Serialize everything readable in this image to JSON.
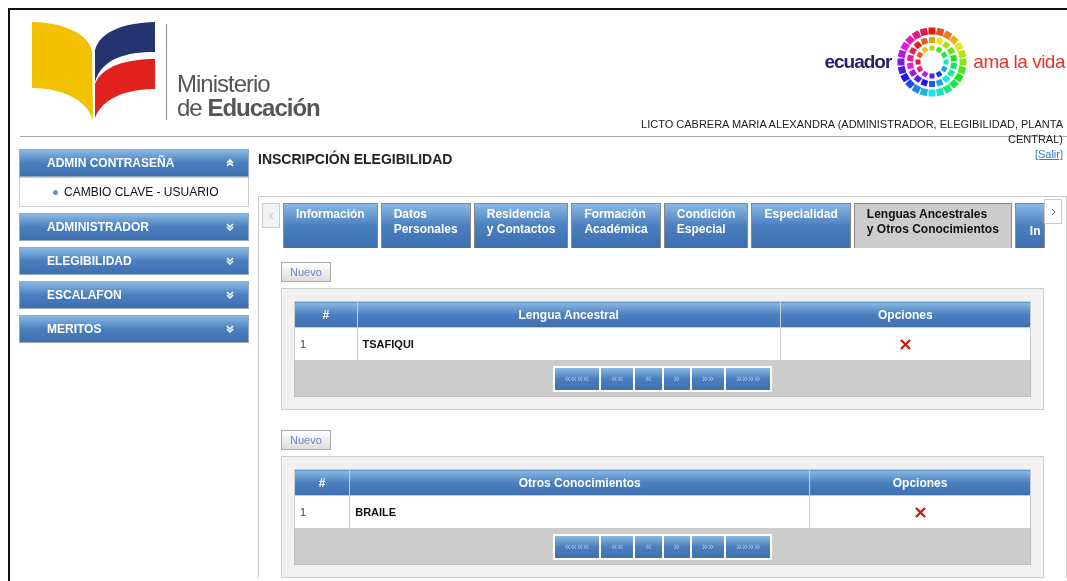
{
  "header": {
    "ministry_line1": "Ministerio",
    "ministry_line2_light": "de",
    "ministry_line2_bold": "Educación",
    "slogan_left": "ecuador",
    "slogan_right": "ama la vida",
    "user": "LICTO CABRERA MARIA ALEXANDRA (ADMINISTRADOR, ELEGIBILIDAD, PLANTA CENTRAL)",
    "logout": "[Salir]"
  },
  "sidebar": {
    "sections": [
      {
        "label": "ADMIN CONTRASEÑA",
        "expanded": true,
        "items": [
          "CAMBIO CLAVE - USUARIO"
        ]
      },
      {
        "label": "ADMINISTRADOR",
        "expanded": false
      },
      {
        "label": "ELEGIBILIDAD",
        "expanded": false
      },
      {
        "label": "ESCALAFON",
        "expanded": false
      },
      {
        "label": "MERITOS",
        "expanded": false
      }
    ]
  },
  "page_title": "INSCRIPCIÓN ELEGIBILIDAD",
  "tabs": [
    {
      "lines": [
        "Información"
      ],
      "selected": false
    },
    {
      "lines": [
        "Datos",
        "Personales"
      ],
      "selected": false
    },
    {
      "lines": [
        "Residencia",
        "y Contactos"
      ],
      "selected": false
    },
    {
      "lines": [
        "Formación",
        "Académica"
      ],
      "selected": false
    },
    {
      "lines": [
        "Condición",
        "Especial"
      ],
      "selected": false
    },
    {
      "lines": [
        "Especialidad"
      ],
      "selected": false
    },
    {
      "lines": [
        "Lenguas Ancestrales",
        "y Otros Conocimientos"
      ],
      "selected": true
    },
    {
      "lines": [
        "In"
      ],
      "selected": false
    }
  ],
  "panels": [
    {
      "new_button": "Nuevo",
      "columns": [
        "#",
        "Lengua Ancestral",
        "Opciones"
      ],
      "rows": [
        {
          "number": "1",
          "value": "TSAFIQUI"
        }
      ],
      "pager": [
        "««««",
        "««",
        "«",
        "»",
        "»»",
        "»»»»"
      ]
    },
    {
      "new_button": "Nuevo",
      "columns": [
        "#",
        "Otros Conocimientos",
        "Opciones"
      ],
      "rows": [
        {
          "number": "1",
          "value": "BRAILE"
        }
      ],
      "pager": [
        "««««",
        "««",
        "«",
        "»",
        "»»",
        "»»»»"
      ]
    }
  ]
}
